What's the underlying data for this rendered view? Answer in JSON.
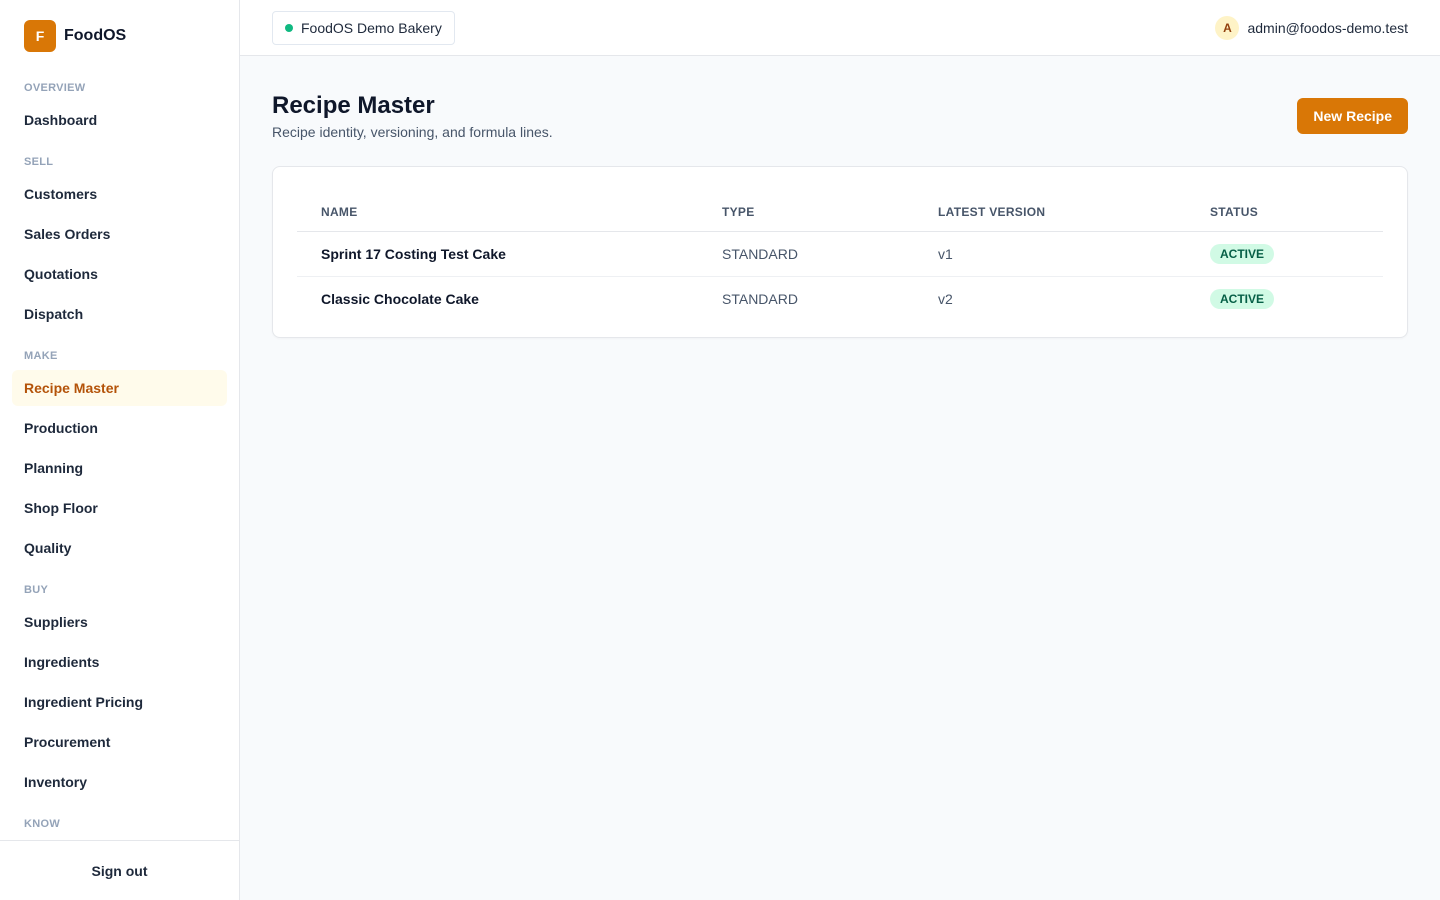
{
  "brand": {
    "logo_letter": "F",
    "name": "FoodOS"
  },
  "sidebar": {
    "sections": [
      {
        "title": "OVERVIEW",
        "items": [
          "Dashboard"
        ]
      },
      {
        "title": "SELL",
        "items": [
          "Customers",
          "Sales Orders",
          "Quotations",
          "Dispatch"
        ]
      },
      {
        "title": "MAKE",
        "items": [
          "Recipe Master",
          "Production",
          "Planning",
          "Shop Floor",
          "Quality"
        ]
      },
      {
        "title": "BUY",
        "items": [
          "Suppliers",
          "Ingredients",
          "Ingredient Pricing",
          "Procurement",
          "Inventory"
        ]
      },
      {
        "title": "KNOW",
        "items": []
      }
    ],
    "active": "Recipe Master",
    "sign_out": "Sign out"
  },
  "topbar": {
    "tenant": "FoodOS Demo Bakery",
    "user_initial": "A",
    "user_email": "admin@foodos-demo.test"
  },
  "page": {
    "title": "Recipe Master",
    "subtitle": "Recipe identity, versioning, and formula lines.",
    "new_button": "New Recipe"
  },
  "table": {
    "headers": [
      "NAME",
      "TYPE",
      "LATEST VERSION",
      "STATUS"
    ],
    "rows": [
      {
        "name": "Sprint 17 Costing Test Cake",
        "type": "STANDARD",
        "version": "v1",
        "status": "ACTIVE"
      },
      {
        "name": "Classic Chocolate Cake",
        "type": "STANDARD",
        "version": "v2",
        "status": "ACTIVE"
      }
    ]
  },
  "colors": {
    "accent": "#d97706",
    "active_bg": "#fffbeb",
    "active_text": "#b45309",
    "status_green": "#10b981"
  }
}
